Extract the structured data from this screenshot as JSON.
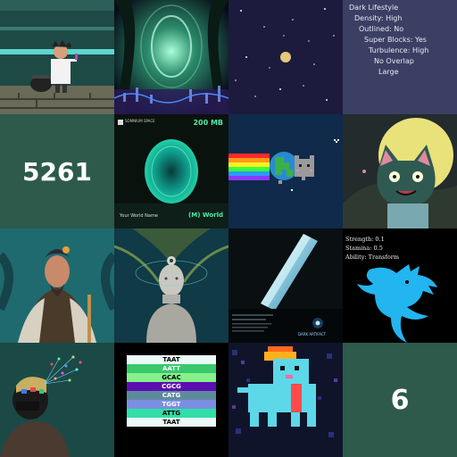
{
  "traits": {
    "lines": [
      "Dark Lifestyle",
      "Density: High",
      "Outlined: No",
      "Super Blocks: Yes",
      "Turbulence: High",
      "No Overlap",
      "Large"
    ]
  },
  "numbers": {
    "first": "5261",
    "second": "6"
  },
  "world_card": {
    "brand": "SOMNIUM SPACE",
    "size": "200 MB",
    "tagline": "Your World Name",
    "badge": "(M) World"
  },
  "stats": {
    "strength": "Strength: 0.1",
    "stamina": "Stamina: 0.5",
    "ability": "Ability: Transform"
  },
  "dna": {
    "codons": [
      "TAAT",
      "AATT",
      "GCAC",
      "CGCG",
      "CATG",
      "TGGT",
      "ATTG",
      "TAAT"
    ]
  },
  "artifact": {
    "caption": "DARK ARTIFACT"
  },
  "colors": {
    "number_tile_bg": "#2d5a4b",
    "traits_bg": "#3a3f63",
    "dragon": "#22b5f0"
  }
}
